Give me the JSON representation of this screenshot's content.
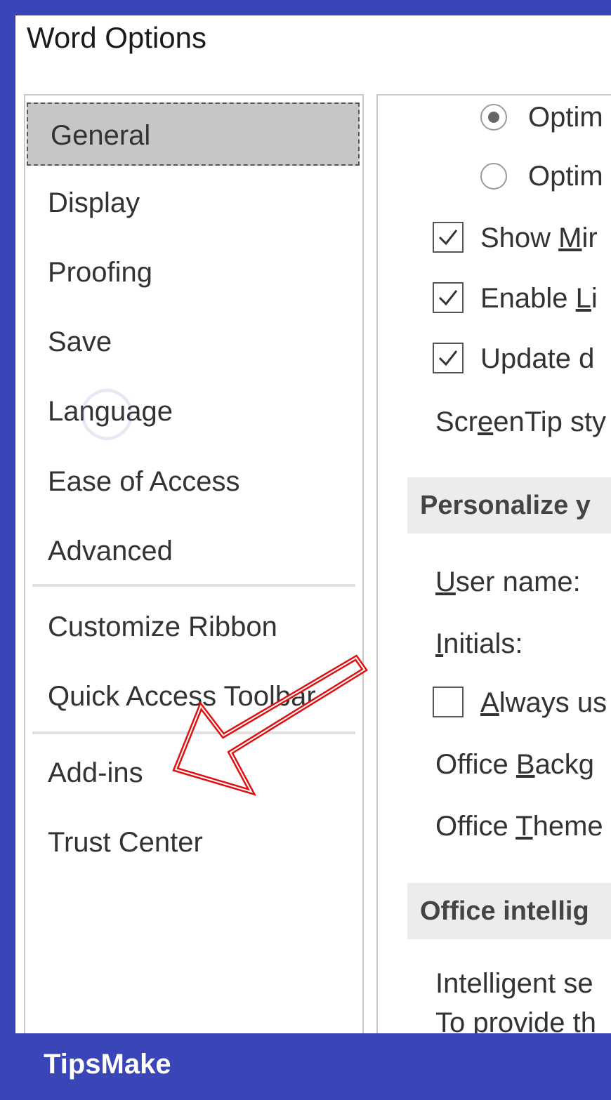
{
  "window": {
    "title": "Word Options"
  },
  "nav": {
    "items": [
      {
        "label": "General",
        "selected": true
      },
      {
        "label": "Display"
      },
      {
        "label": "Proofing"
      },
      {
        "label": "Save"
      },
      {
        "label": "Language"
      },
      {
        "label": "Ease of Access"
      },
      {
        "label": "Advanced"
      },
      {
        "label": "Customize Ribbon"
      },
      {
        "label": "Quick Access Toolbar"
      },
      {
        "label": "Add-ins"
      },
      {
        "label": "Trust Center"
      }
    ]
  },
  "content": {
    "radio1": "Optim",
    "radio2": "Optim",
    "chk_show": {
      "pre": "Show ",
      "u": "M",
      "post": "ir"
    },
    "chk_enable": {
      "pre": "Enable ",
      "u": "L",
      "post": "i"
    },
    "chk_update": "Update d",
    "screentip": {
      "pre": "Scr",
      "u": "e",
      "post": "enTip sty"
    },
    "section_personalize": "Personalize y",
    "username": {
      "u": "U",
      "post": "ser name:"
    },
    "initials": {
      "u": "I",
      "post": "nitials:"
    },
    "always": {
      "u": "A",
      "post": "lways us"
    },
    "office_bg": {
      "pre": "Office ",
      "u": "B",
      "post": "ackg"
    },
    "office_theme": {
      "pre": "Office ",
      "u": "T",
      "post": "heme"
    },
    "section_intel": "Office intellig",
    "intel_line1": "Intelligent se",
    "intel_line2": "To provide th"
  },
  "footer": {
    "brand": "TipsMake"
  },
  "annotation": {
    "arrow_color": "#e01010"
  }
}
